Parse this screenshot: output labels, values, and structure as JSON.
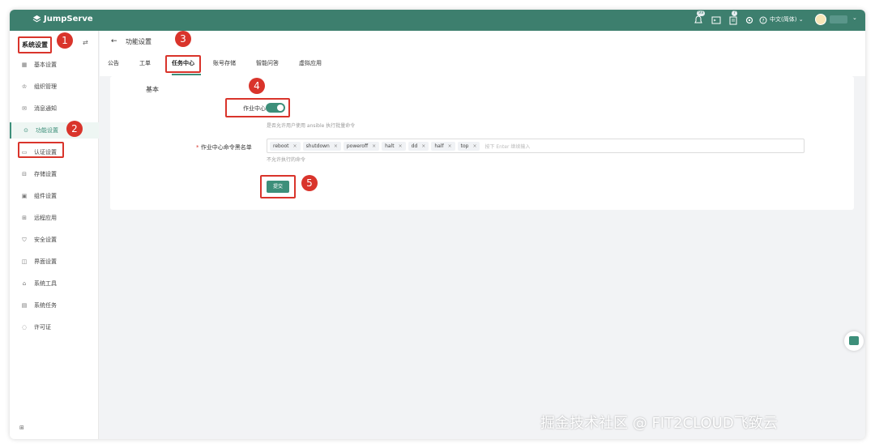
{
  "app": {
    "name": "JumpServe"
  },
  "topbar": {
    "notify_badge": "99",
    "message_badge": "7",
    "language": "中文(简体)",
    "language_chevron": "⌄",
    "user_chevron": "⌄"
  },
  "sidebar": {
    "title": "系统设置",
    "items": [
      {
        "icon": "grid",
        "label": "基本设置"
      },
      {
        "icon": "org",
        "label": "组织管理"
      },
      {
        "icon": "mail",
        "label": "消息通知"
      },
      {
        "icon": "feature",
        "label": "功能设置"
      },
      {
        "icon": "auth",
        "label": "认证设置"
      },
      {
        "icon": "storage",
        "label": "存储设置"
      },
      {
        "icon": "component",
        "label": "组件设置"
      },
      {
        "icon": "remote",
        "label": "远程应用"
      },
      {
        "icon": "shield",
        "label": "安全设置"
      },
      {
        "icon": "interface",
        "label": "界面设置"
      },
      {
        "icon": "tool",
        "label": "系统工具"
      },
      {
        "icon": "task",
        "label": "系统任务"
      },
      {
        "icon": "license",
        "label": "许可证"
      }
    ],
    "active_index": 3
  },
  "header": {
    "back": "←",
    "title": "功能设置",
    "tabs": [
      "公告",
      "工单",
      "任务中心",
      "账号存储",
      "智能问答",
      "虚拟应用"
    ],
    "active_tab": "任务中心"
  },
  "form": {
    "section": "基本",
    "job_center": {
      "label": "作业中心",
      "enabled": true,
      "hint": "是否允许用户使用 ansible 执行批量命令"
    },
    "blacklist": {
      "required_mark": "*",
      "label": "作业中心命令黑名单",
      "tags": [
        "reboot",
        "shutdown",
        "poweroff",
        "halt",
        "dd",
        "half",
        "top"
      ],
      "input_placeholder": "按下 Enter 继续输入",
      "hint": "不允许执行的命令"
    },
    "submit": "提交"
  },
  "annotations": [
    "1",
    "2",
    "3",
    "4",
    "5"
  ],
  "watermark": "掘金技术社区 @ FIT2CLOUD飞致云"
}
